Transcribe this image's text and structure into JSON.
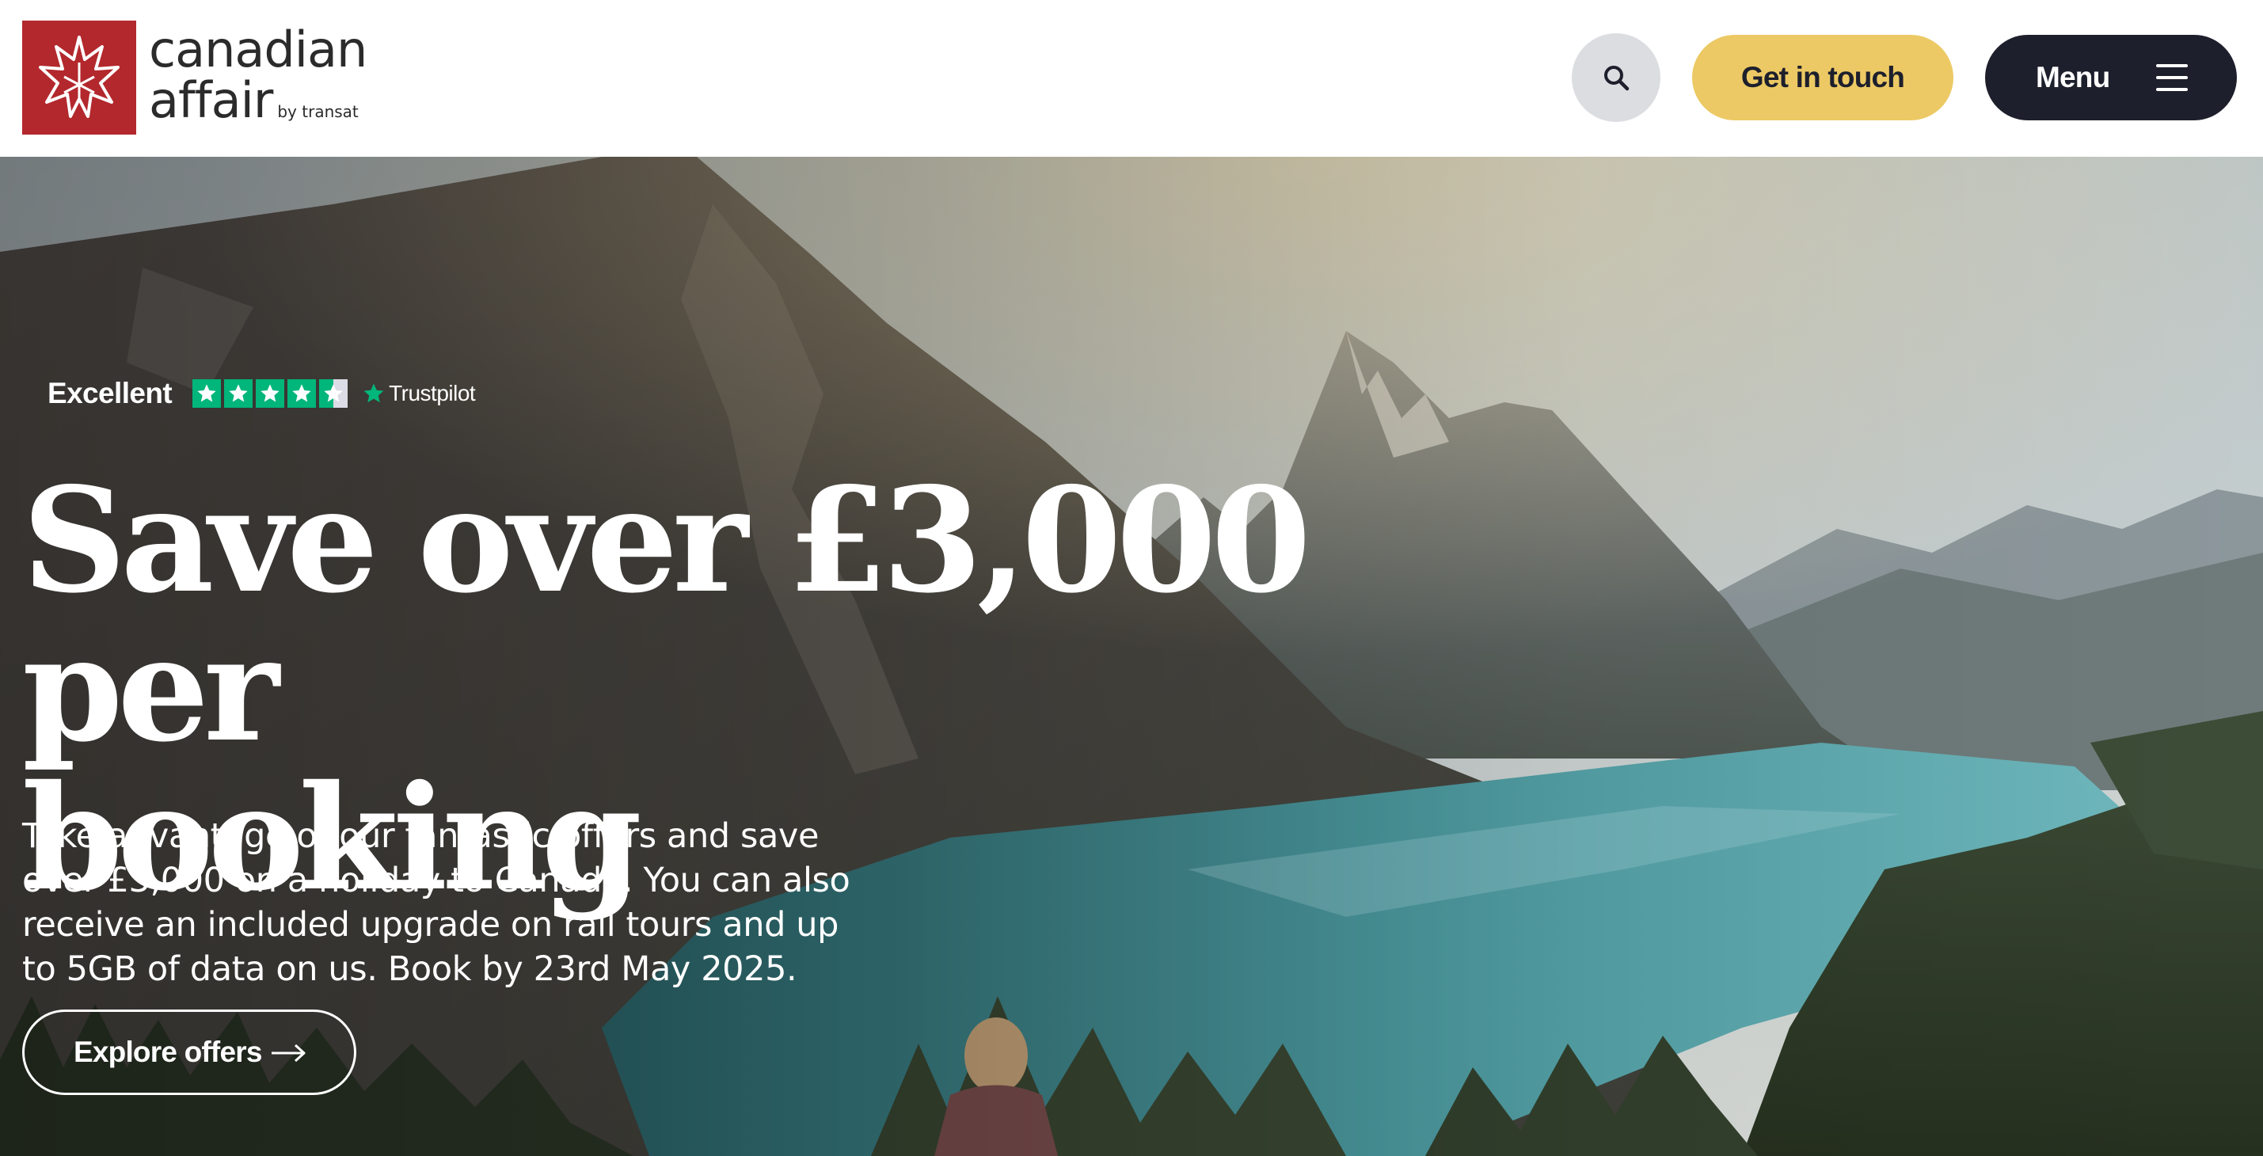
{
  "brand": {
    "name_line1": "canadian",
    "name_line2": "affair",
    "byline": "by transat",
    "logo_color": "#b3282d"
  },
  "header": {
    "search_icon": "search-icon",
    "get_in_touch_label": "Get in touch",
    "menu_label": "Menu",
    "menu_icon": "hamburger-icon",
    "accent_color": "#ecc964",
    "dark_color": "#1d1f2c"
  },
  "hero": {
    "rating_label": "Excellent",
    "rating_stars": 4.5,
    "rating_provider": "Trustpilot",
    "headline_line1": "Save over £3,000 per",
    "headline_line2": "booking",
    "intro": "Take advantage of our fantastic offers and save over £3,000 on a holiday to Canada. You can also receive an included upgrade on rail tours and up to 5GB of data on us. Book by 23rd May 2025.",
    "cta_label": "Explore offers",
    "cta_icon": "arrow-right-icon"
  }
}
